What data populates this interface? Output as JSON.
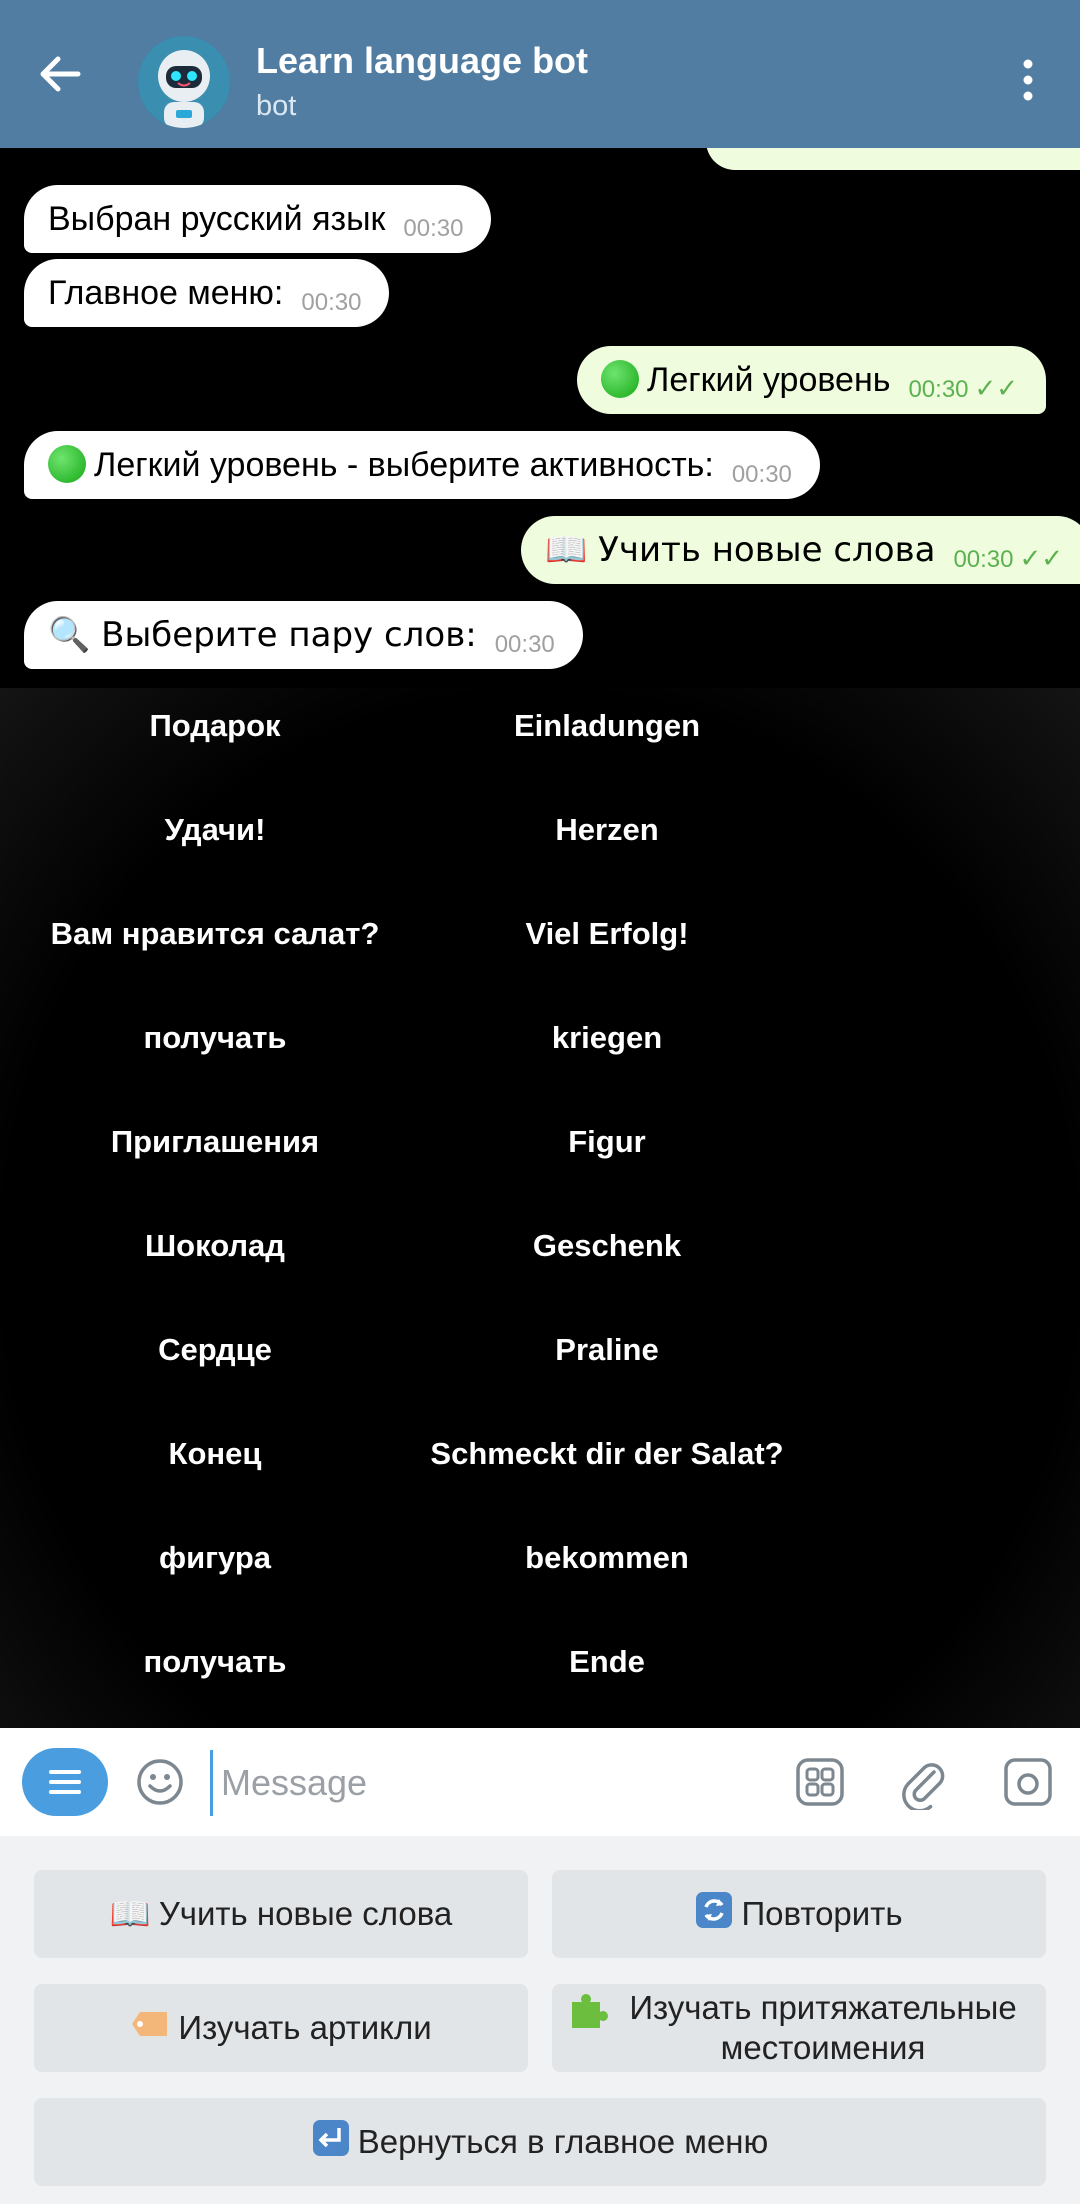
{
  "header": {
    "title": "Learn language bot",
    "subtitle": "bot"
  },
  "messages": [
    {
      "dir": "in",
      "text": "Выбран русский язык",
      "time": "00:30"
    },
    {
      "dir": "in",
      "text": "Главное меню:",
      "time": "00:30"
    },
    {
      "dir": "out",
      "text": "Легкий уровень",
      "time": "00:30",
      "icon": "green-circle"
    },
    {
      "dir": "in",
      "text": "Легкий уровень - выберите активность:",
      "time": "00:30",
      "icon": "green-circle"
    },
    {
      "dir": "out",
      "text": "📖 Учить новые слова",
      "time": "00:30"
    },
    {
      "dir": "in",
      "text": "🔍 Выберите пару слов:",
      "time": "00:30"
    }
  ],
  "word_pairs": [
    {
      "ru": "Подарок",
      "de": "Einladungen"
    },
    {
      "ru": "Удачи!",
      "de": "Herzen"
    },
    {
      "ru": "Вам нравится салат?",
      "de": "Viel Erfolg!"
    },
    {
      "ru": "получать",
      "de": "kriegen"
    },
    {
      "ru": "Приглашения",
      "de": "Figur"
    },
    {
      "ru": "Шоколад",
      "de": "Geschenk"
    },
    {
      "ru": "Сердце",
      "de": "Praline"
    },
    {
      "ru": "Конец",
      "de": "Schmeckt dir der Salat?"
    },
    {
      "ru": "фигура",
      "de": "bekommen"
    },
    {
      "ru": "получать",
      "de": "Ende"
    }
  ],
  "input": {
    "placeholder": "Message"
  },
  "reply_keyboard": {
    "learn_words": "Учить новые слова",
    "repeat": "Повторить",
    "articles": "Изучать артикли",
    "pronouns": "Изучать притяжательные местоимения",
    "main_menu": "Вернуться в главное меню"
  },
  "colors": {
    "header": "#517da2",
    "outgoing_bubble": "#effdde",
    "accent": "#4a9ee0",
    "check_marks": "#5cb150"
  }
}
